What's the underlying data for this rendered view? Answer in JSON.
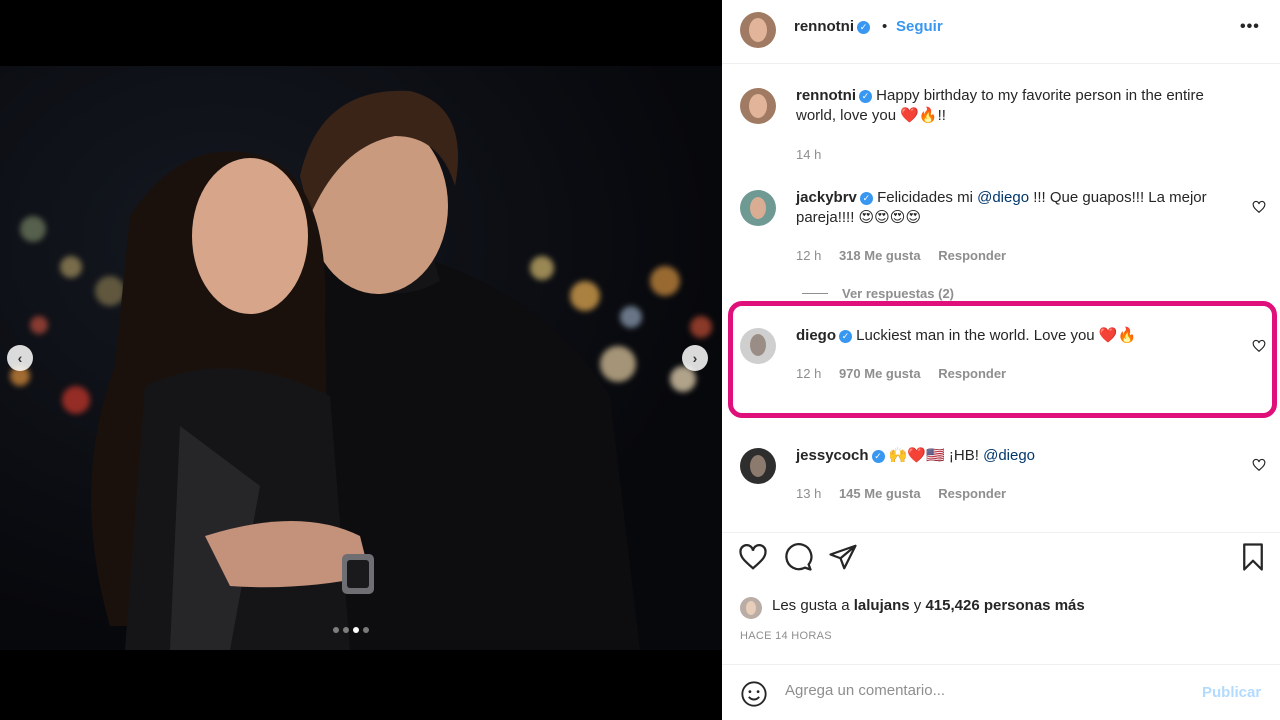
{
  "header": {
    "username": "rennotni",
    "separator": "•",
    "follow_label": "Seguir",
    "more_icon": "more-options-icon"
  },
  "caption": {
    "username": "rennotni",
    "text": "Happy birthday to my favorite person in the entire world, love you ❤️🔥!!",
    "time": "14 h"
  },
  "comments": [
    {
      "username": "jackybrv",
      "text_before": "Felicidades mi ",
      "mention": "@diego",
      "text_after": " !!! Que guapos!!! La mejor pareja!!!! 😍😍😍😍",
      "time": "12 h",
      "likes": "318 Me gusta",
      "reply": "Responder",
      "view_replies": "Ver respuestas (2)"
    },
    {
      "username": "diego",
      "text": "Luckiest man in the world. Love you ❤️🔥",
      "time": "12 h",
      "likes": "970 Me gusta",
      "reply": "Responder"
    },
    {
      "username": "jessycoch",
      "text_before": "🙌❤️🇺🇸 ¡HB! ",
      "mention": "@diego",
      "time": "13 h",
      "likes": "145 Me gusta",
      "reply": "Responder"
    }
  ],
  "likes_line": {
    "prefix": "Les gusta a ",
    "user": "lalujans",
    "middle": " y ",
    "count": "415,426 personas más"
  },
  "timestamp": "HACE 14 HORAS",
  "comment_input": {
    "placeholder": "Agrega un comentario...",
    "publish_label": "Publicar"
  },
  "colors": {
    "accent": "#3897f0",
    "highlight": "#e0107a",
    "muted": "#8e8e8e"
  }
}
